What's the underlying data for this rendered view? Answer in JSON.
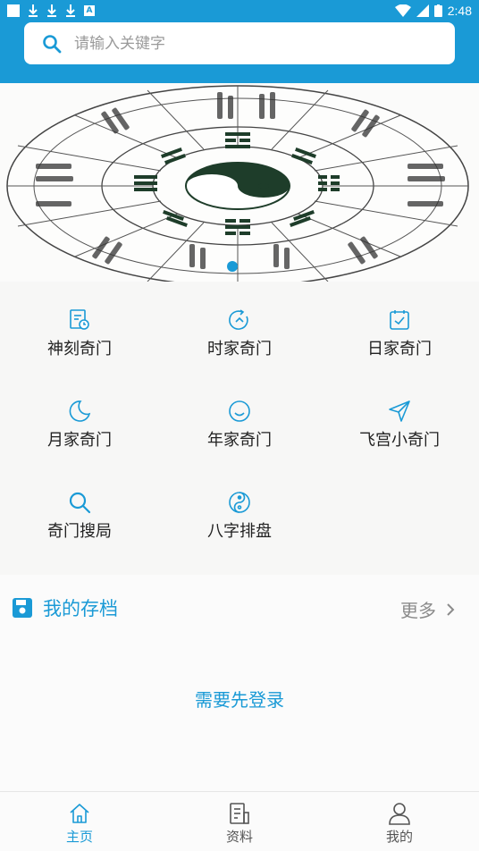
{
  "status_bar": {
    "time": "2:48",
    "notification_badge": "A"
  },
  "search": {
    "placeholder": "请输入关键字"
  },
  "banner": {
    "image": "bagua-compass-chart",
    "page_indicator": {
      "current": 1
    }
  },
  "menu": [
    {
      "label": "神刻奇门",
      "icon": "calendar-clock-icon"
    },
    {
      "label": "时家奇门",
      "icon": "clock-refresh-icon"
    },
    {
      "label": "日家奇门",
      "icon": "calendar-check-icon"
    },
    {
      "label": "月家奇门",
      "icon": "moon-icon"
    },
    {
      "label": "年家奇门",
      "icon": "smile-icon"
    },
    {
      "label": "飞宫小奇门",
      "icon": "send-icon"
    },
    {
      "label": "奇门搜局",
      "icon": "search-icon"
    },
    {
      "label": "八字排盘",
      "icon": "yin-yang-icon"
    }
  ],
  "archive": {
    "title": "我的存档",
    "more_label": "更多",
    "login_hint": "需要先登录"
  },
  "tabs": [
    {
      "label": "主页",
      "icon": "home-icon",
      "active": true
    },
    {
      "label": "资料",
      "icon": "document-icon",
      "active": false
    },
    {
      "label": "我的",
      "icon": "user-icon",
      "active": false
    }
  ],
  "colors": {
    "accent": "#1a9ad6",
    "text": "#222222",
    "muted": "#8b8b8b"
  }
}
